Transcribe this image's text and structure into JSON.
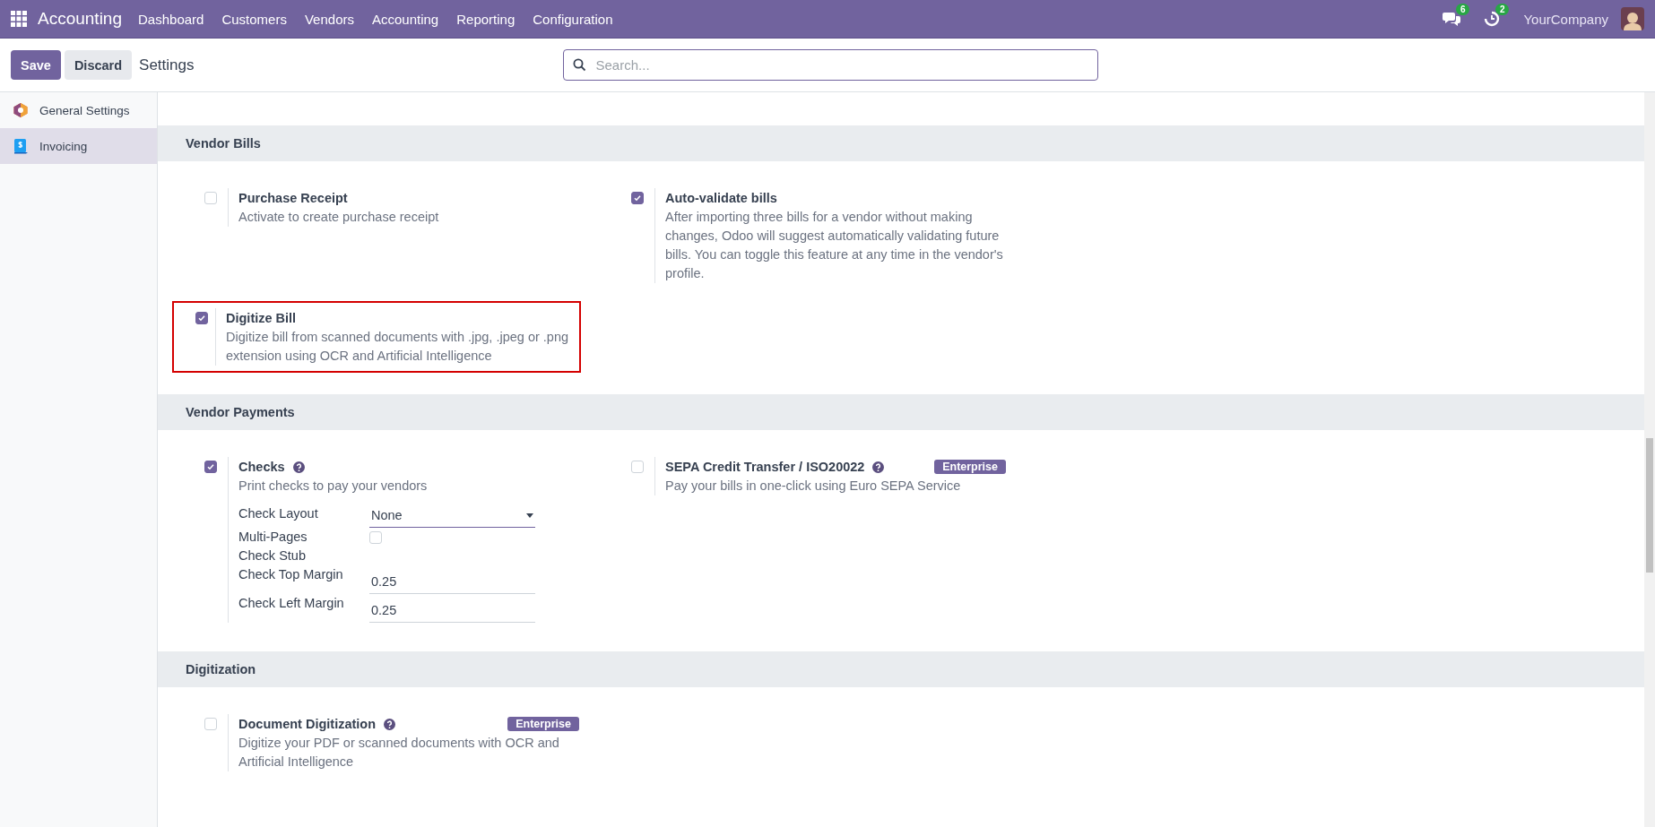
{
  "navbar": {
    "app_name": "Accounting",
    "menu": [
      "Dashboard",
      "Customers",
      "Vendors",
      "Accounting",
      "Reporting",
      "Configuration"
    ],
    "messages_count": "6",
    "activities_count": "2",
    "company": "YourCompany"
  },
  "control_bar": {
    "buttons": [
      {
        "label": "Save",
        "kind": "primary"
      },
      {
        "label": "Discard",
        "kind": "secondary"
      }
    ],
    "title": "Settings"
  },
  "search": {
    "placeholder": "Search..."
  },
  "sidebar": {
    "items": [
      {
        "label": "General Settings",
        "kind": "general",
        "selected": false
      },
      {
        "label": "Invoicing",
        "kind": "invoicing",
        "selected": true
      }
    ]
  },
  "sections": [
    {
      "title": "Vendor Bills",
      "settings": [
        {
          "title": "Purchase Receipt",
          "checked": false,
          "help": false,
          "highlighted": false,
          "description": "Activate to create purchase receipt"
        },
        {
          "title": "Auto-validate bills",
          "checked": true,
          "help": false,
          "highlighted": false,
          "description": "After importing three bills for a vendor without making changes, Odoo will suggest automatically validating future bills. You can toggle this feature at any time in the vendor's profile."
        },
        {
          "title": "Digitize Bill",
          "checked": true,
          "help": false,
          "highlighted": true,
          "description": "Digitize bill from scanned documents with .jpg, .jpeg or .png extension using OCR and Artificial Intelligence"
        }
      ]
    },
    {
      "title": "Vendor Payments",
      "settings": [
        {
          "title": "Checks",
          "checked": true,
          "help": true,
          "highlighted": false,
          "description": "Print checks to pay your vendors",
          "fields": [
            {
              "label": "Check Layout",
              "kind": "select",
              "value": "None"
            },
            {
              "label": "Multi-Pages Check Stub",
              "kind": "checkbox",
              "checked": false
            },
            {
              "label": "Check Top Margin",
              "kind": "text",
              "value": "0.25"
            },
            {
              "label": "Check Left Margin",
              "kind": "text",
              "value": "0.25"
            }
          ]
        },
        {
          "title": "SEPA Credit Transfer / ISO20022",
          "checked": false,
          "help": true,
          "highlighted": false,
          "badge": "Enterprise",
          "description": "Pay your bills in one-click using Euro SEPA Service"
        }
      ]
    },
    {
      "title": "Digitization",
      "settings": [
        {
          "title": "Document Digitization",
          "checked": false,
          "help": true,
          "highlighted": false,
          "badge": "Enterprise",
          "description": "Digitize your PDF or scanned documents with OCR and Artificial Intelligence"
        }
      ]
    }
  ]
}
